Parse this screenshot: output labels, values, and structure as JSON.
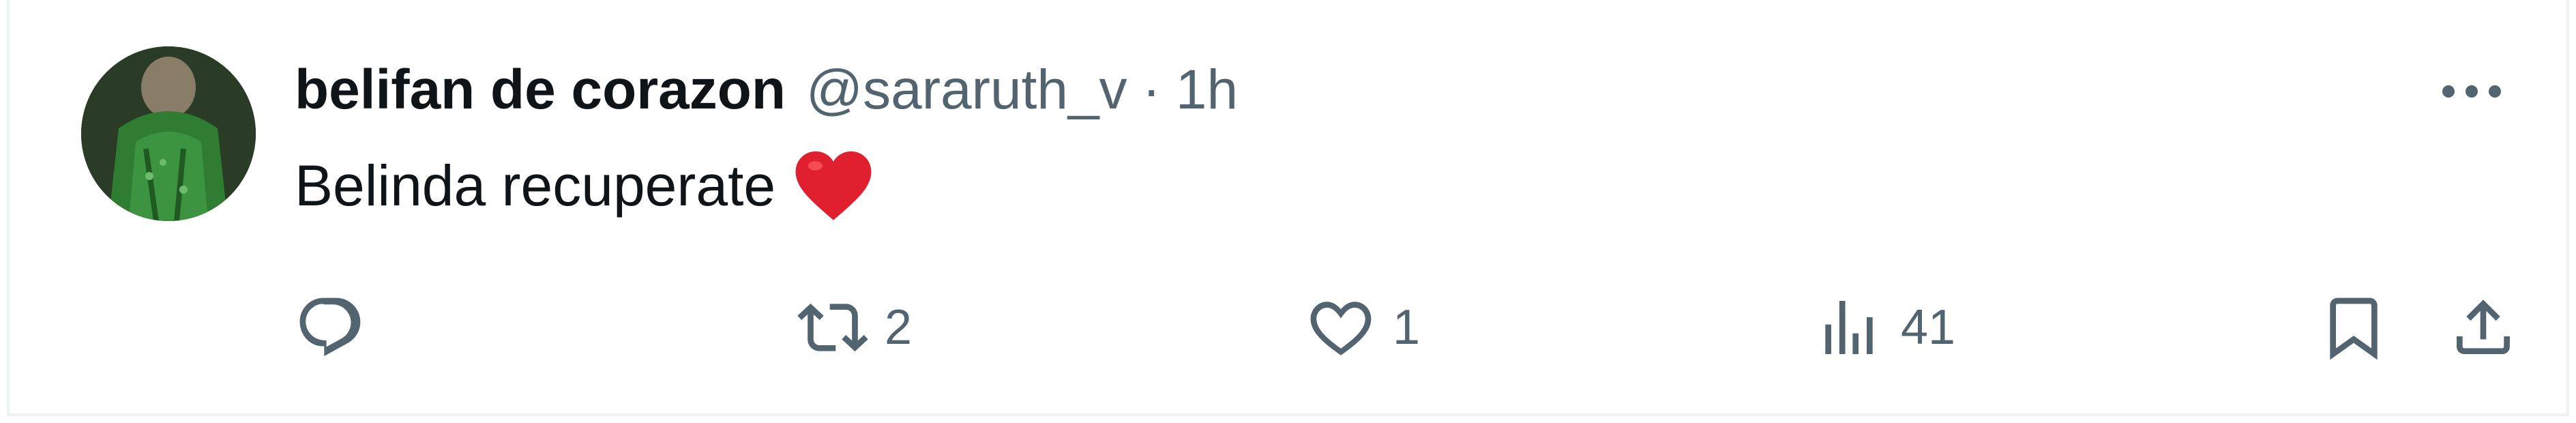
{
  "tweet": {
    "author": {
      "display_name": "belifan de corazon",
      "handle": "@sararuth_v",
      "separator": "·",
      "time": "1h"
    },
    "text": "Belinda recuperate",
    "emoji": "red-heart",
    "actions": {
      "reply": {
        "icon": "reply-icon",
        "count": ""
      },
      "retweet": {
        "icon": "retweet-icon",
        "count": "2"
      },
      "like": {
        "icon": "heart-outline-icon",
        "count": "1"
      },
      "views": {
        "icon": "views-chart-icon",
        "count": "41"
      },
      "bookmark": {
        "icon": "bookmark-icon"
      },
      "share": {
        "icon": "share-icon"
      }
    },
    "more": {
      "icon": "more-icon"
    }
  },
  "colors": {
    "text_primary": "#0f1419",
    "text_secondary": "#536471",
    "heart_emoji": "#e0202e",
    "border": "#eff3f4"
  }
}
